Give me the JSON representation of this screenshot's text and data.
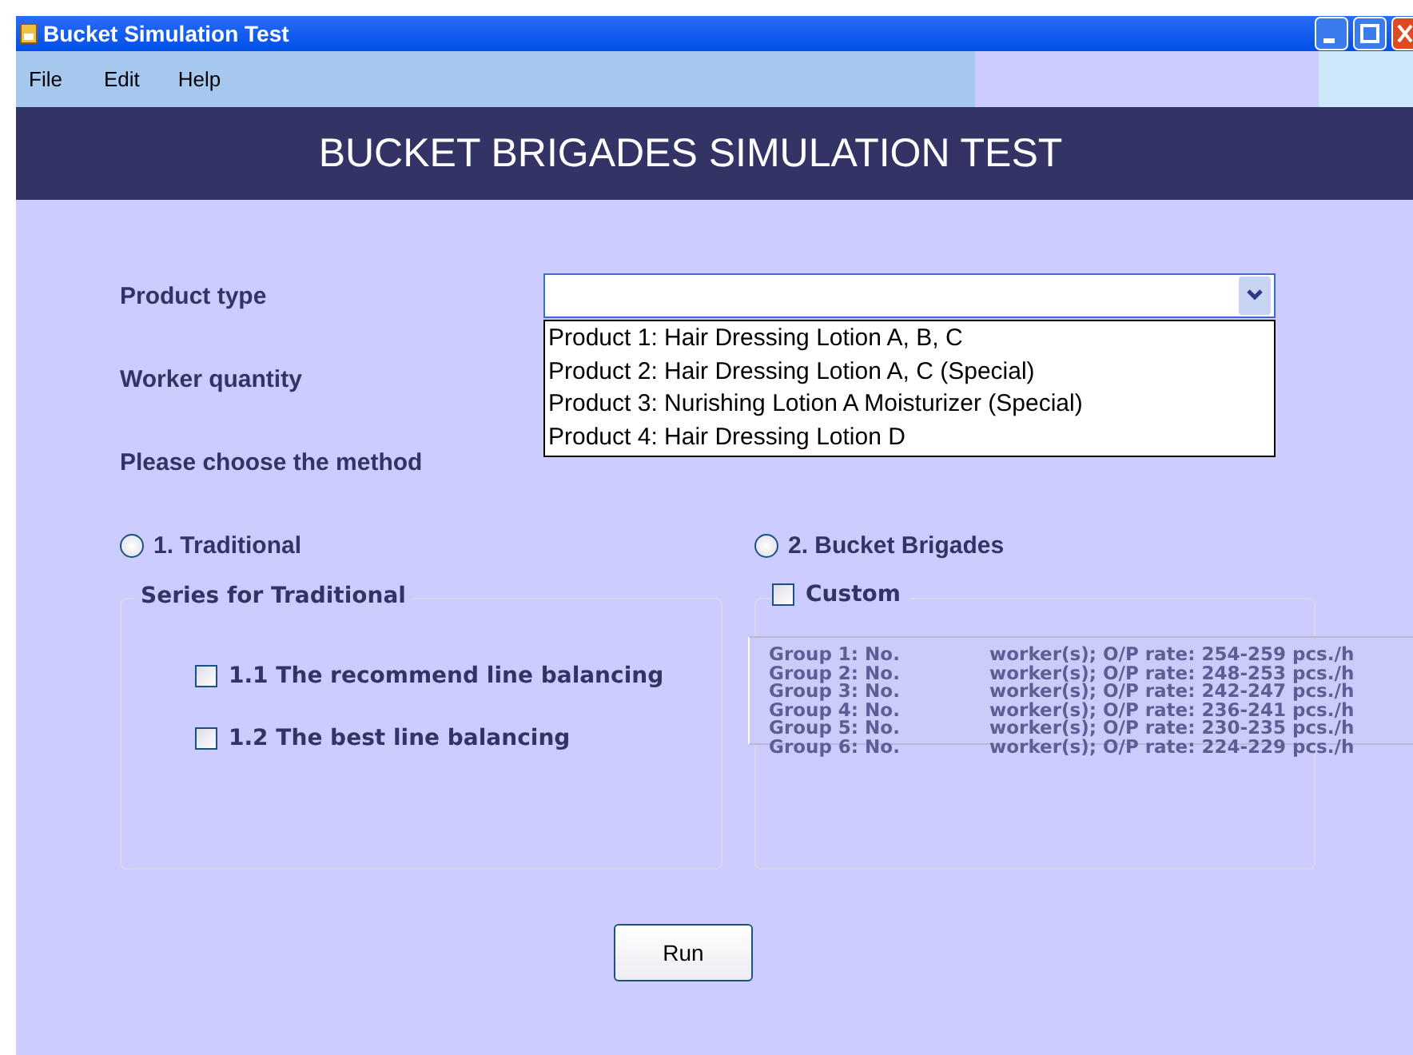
{
  "window": {
    "title": "Bucket Simulation Test"
  },
  "menu": [
    "File",
    "Edit",
    "Help"
  ],
  "header": "BUCKET BRIGADES SIMULATION TEST",
  "product_type": {
    "label": "Product type",
    "expanded": true,
    "options": [
      "Product 1:  Hair Dressing Lotion A, B, C",
      "Product 2:  Hair Dressing Lotion A, C (Special)",
      "Product 3:  Nurishing Lotion A Moisturizer (Special)",
      "Product 4:  Hair Dressing Lotion D"
    ]
  },
  "worker_quantity": {
    "label": "Worker quantity"
  },
  "method_prompt": "Please choose the method",
  "methods": [
    {
      "label": "1. Traditional",
      "selected": false
    },
    {
      "label": "2. Bucket Brigades",
      "selected": false
    }
  ],
  "traditional_series": {
    "title": "Series for Traditional",
    "options": [
      {
        "label": "1.1 The recommend line balancing",
        "checked": false
      },
      {
        "label": "1.2 The best line balancing",
        "checked": false
      }
    ]
  },
  "custom": {
    "label": "Custom",
    "checked": false,
    "groups": [
      {
        "label": "Group 1: No.",
        "rate": "worker(s); O/P rate: 254-259 pcs./h"
      },
      {
        "label": "Group 2: No.",
        "rate": "worker(s); O/P rate: 248-253 pcs./h"
      },
      {
        "label": "Group 3: No.",
        "rate": "worker(s); O/P rate: 242-247 pcs./h"
      },
      {
        "label": "Group 4: No.",
        "rate": "worker(s); O/P rate: 236-241 pcs./h"
      },
      {
        "label": "Group 5: No.",
        "rate": "worker(s); O/P rate: 230-235 pcs./h"
      },
      {
        "label": "Group 6: No.",
        "rate": "worker(s); O/P rate: 224-229 pcs./h"
      }
    ]
  },
  "run_button": "Run"
}
